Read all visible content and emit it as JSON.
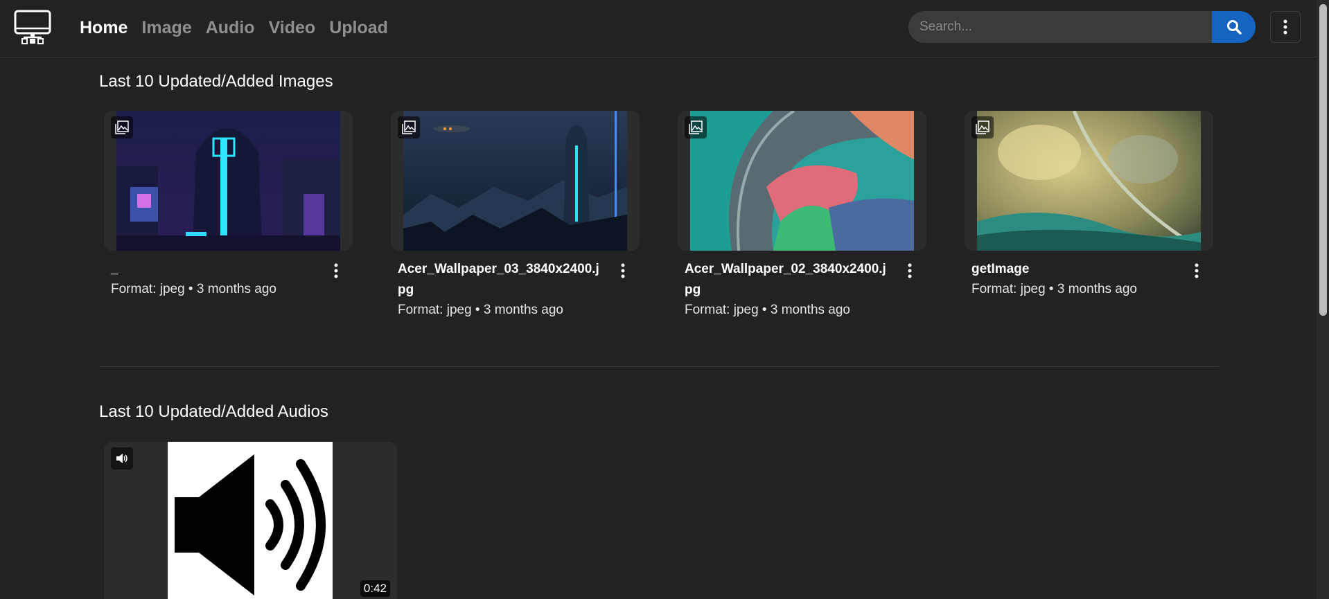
{
  "nav": {
    "logo_icon": "monitor-icon",
    "links": [
      {
        "label": "Home",
        "active": true
      },
      {
        "label": "Image",
        "active": false
      },
      {
        "label": "Audio",
        "active": false
      },
      {
        "label": "Video",
        "active": false
      },
      {
        "label": "Upload",
        "active": false
      }
    ],
    "search_placeholder": "Search...",
    "search_icon": "search-icon",
    "menu_icon": "kebab-menu-icon"
  },
  "images_section": {
    "title": "Last 10 Updated/Added Images",
    "items": [
      {
        "title": "_",
        "subtitle": "Format: jpeg • 3 months ago",
        "thumbnail": "neon-cyberpunk-city"
      },
      {
        "title": "Acer_Wallpaper_03_3840x2400.jpg",
        "subtitle": "Format: jpeg • 3 months ago",
        "thumbnail": "dark-blue-city-skyline"
      },
      {
        "title": "Acer_Wallpaper_02_3840x2400.jpg",
        "subtitle": "Format: jpeg • 3 months ago",
        "thumbnail": "teal-abstract-waves"
      },
      {
        "title": "getImage",
        "subtitle": "Format: jpeg • 3 months ago",
        "thumbnail": "gold-green-abstract"
      }
    ]
  },
  "audios_section": {
    "title": "Last 10 Updated/Added Audios",
    "items": [
      {
        "duration": "0:42",
        "thumbnail": "speaker-icon"
      }
    ]
  },
  "colors": {
    "background": "#222222",
    "accent": "#1565c0",
    "muted_nav": "#8f8f8f"
  }
}
